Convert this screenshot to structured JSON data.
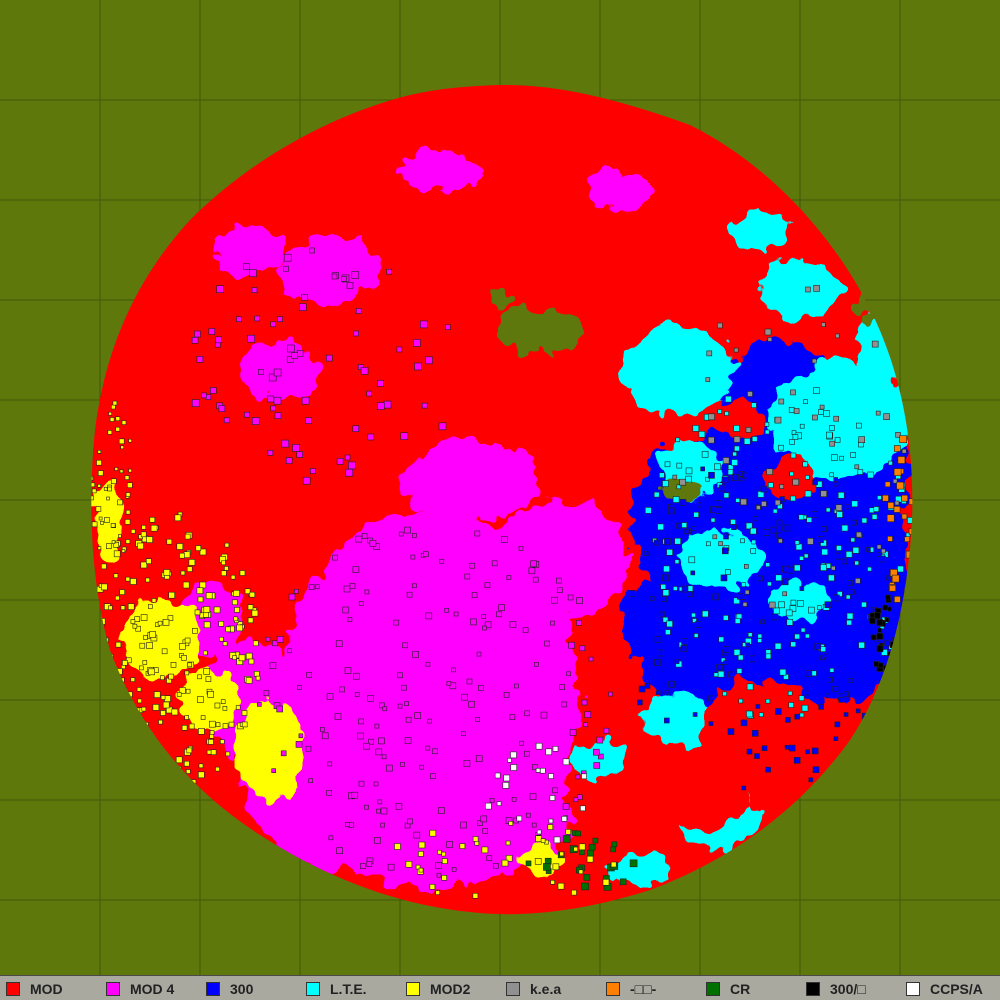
{
  "map": {
    "background_color": "#5f780b",
    "grid_color": "#3f5a08",
    "grid_cell_count": 10
  },
  "legend": {
    "items": [
      {
        "label": "MOD",
        "color": "#ff0000"
      },
      {
        "label": "MOD 4",
        "color": "#ff00ff"
      },
      {
        "label": "300",
        "color": "#0000ff"
      },
      {
        "label": "L.T.E.",
        "color": "#00ffff"
      },
      {
        "label": "MOD2",
        "color": "#ffff00"
      },
      {
        "label": "k.e.a",
        "color": "#909090"
      },
      {
        "label": "-□□-",
        "color": "#ff8000"
      },
      {
        "label": "CR",
        "color": "#007000"
      },
      {
        "label": "300/□",
        "color": "#000000"
      },
      {
        "label": "CCPS/A",
        "color": "#ffffff"
      }
    ]
  }
}
